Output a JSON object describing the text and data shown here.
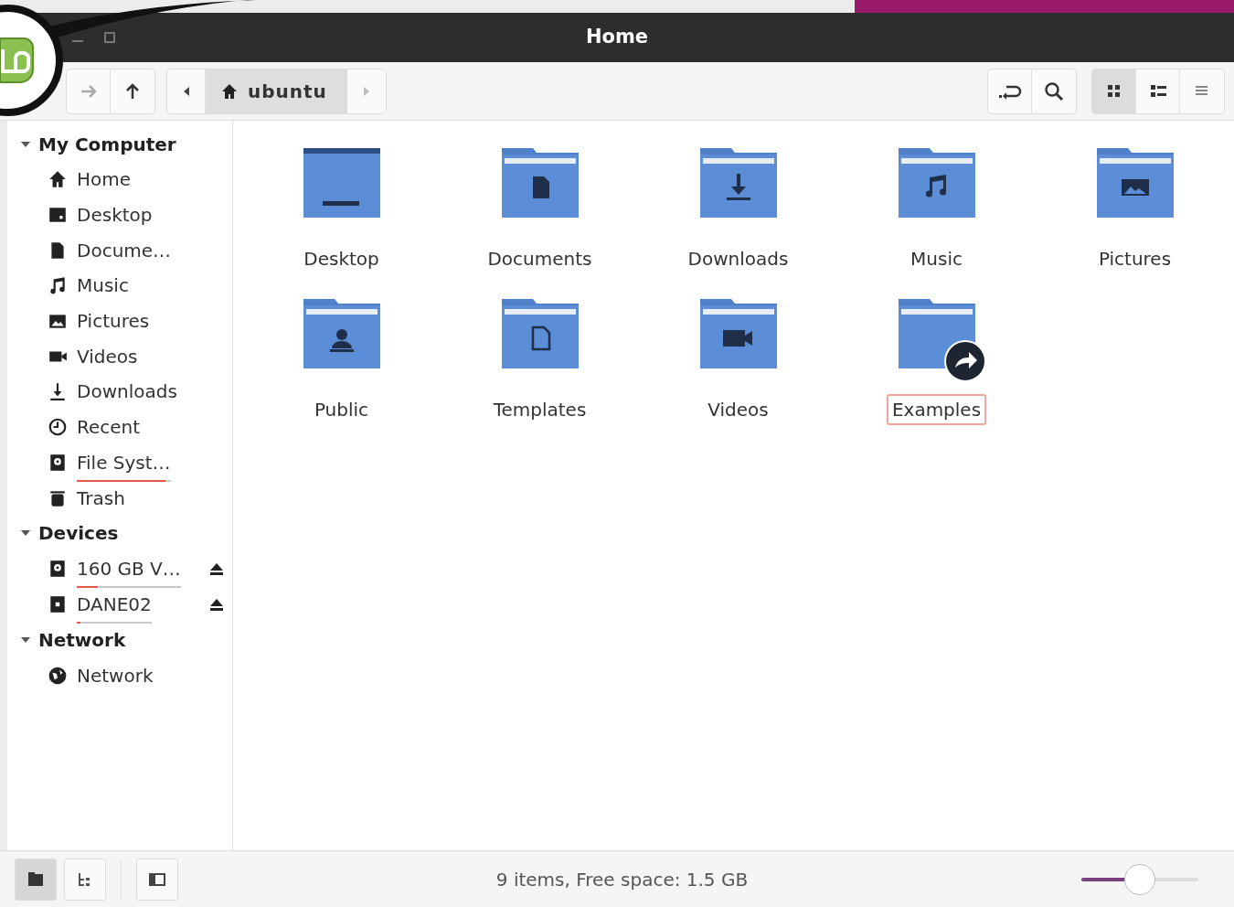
{
  "window": {
    "title": "Home"
  },
  "toolbar": {
    "path": [
      {
        "kind": "home",
        "label": "ubuntu",
        "selected": true
      }
    ],
    "view_modes": [
      {
        "kind": "icons",
        "selected": true
      },
      {
        "kind": "compact",
        "selected": false
      },
      {
        "kind": "list",
        "selected": false
      }
    ]
  },
  "sidebar": {
    "sections": [
      {
        "label": "My Computer",
        "expanded": true,
        "items": [
          {
            "kind": "home",
            "label": "Home"
          },
          {
            "kind": "desktop",
            "label": "Desktop"
          },
          {
            "kind": "documents",
            "label": "Docume…"
          },
          {
            "kind": "music",
            "label": "Music"
          },
          {
            "kind": "pictures",
            "label": "Pictures"
          },
          {
            "kind": "videos",
            "label": "Videos"
          },
          {
            "kind": "downloads",
            "label": "Downloads"
          },
          {
            "kind": "recent",
            "label": "Recent"
          },
          {
            "kind": "drive",
            "label": "File Syst…",
            "level": 0.95
          },
          {
            "kind": "trash",
            "label": "Trash"
          }
        ]
      },
      {
        "label": "Devices",
        "expanded": true,
        "items": [
          {
            "kind": "drive",
            "label": "160 GB V…",
            "level": 0.2,
            "ejectable": true
          },
          {
            "kind": "usb",
            "label": "DANE02",
            "level": 0.05,
            "ejectable": true
          }
        ]
      },
      {
        "label": "Network",
        "expanded": true,
        "items": [
          {
            "kind": "network",
            "label": "Network"
          }
        ]
      }
    ]
  },
  "files": [
    {
      "kind": "desktop",
      "name": "Desktop",
      "selected": false,
      "linked": false
    },
    {
      "kind": "documents",
      "name": "Documents",
      "selected": false,
      "linked": false
    },
    {
      "kind": "downloads",
      "name": "Downloads",
      "selected": false,
      "linked": false
    },
    {
      "kind": "music",
      "name": "Music",
      "selected": false,
      "linked": false
    },
    {
      "kind": "pictures",
      "name": "Pictures",
      "selected": false,
      "linked": false
    },
    {
      "kind": "public",
      "name": "Public",
      "selected": false,
      "linked": false
    },
    {
      "kind": "templates",
      "name": "Templates",
      "selected": false,
      "linked": false
    },
    {
      "kind": "videos",
      "name": "Videos",
      "selected": false,
      "linked": false
    },
    {
      "kind": "plain",
      "name": "Examples",
      "selected": true,
      "linked": true
    }
  ],
  "status_bar": {
    "panes": [
      {
        "kind": "places",
        "selected": true
      },
      {
        "kind": "tree",
        "selected": false
      }
    ],
    "text": "9 items, Free space: 1.5 GB",
    "zoom": {
      "level": 0.5
    }
  }
}
